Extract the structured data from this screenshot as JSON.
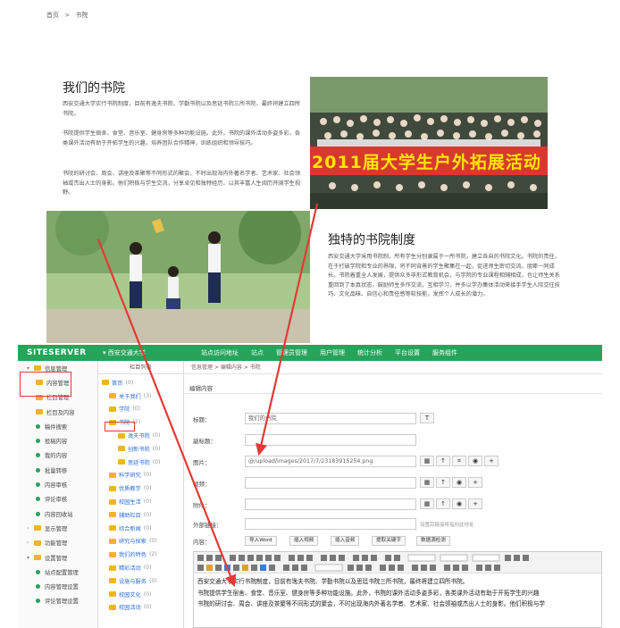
{
  "breadcrumb": {
    "home": "首页",
    "sep": ">",
    "current": "书院"
  },
  "section1": {
    "title": "我们的书院",
    "paragraphs": [
      "西安交通大学实行书院制度，目前有逸夫书院、学勤书院以及思廷书院三所书院，最终将建立四所书院。",
      "书院提供学生宿舍、食堂、音乐室、健身房等多种功能设施。此外，书院的课外活动多姿多彩，各类课外活动有助于开拓学生的兴趣，培养团队合作精神，训练组织和领导技巧。",
      "书院的研讨会、周会、讲座及茶聚等不同形式的聚会，不时出现海内外著名学者、艺术家、社会领袖或杰出人士的身影。他们积极与学生交流，分享卓见和独特经历，以其丰富人生阅历开阔学生视野。"
    ],
    "banner_text": "2011届大学生户外拓展活动"
  },
  "section2": {
    "title": "独特的书院制度",
    "paragraph": "西安交通大学采用书院制，所有学生分别隶属于一所书院，建立各自的书院文化。书院的责任，在于打破学院和专业的界限，将不同背景的学生聚集在一起，促进师生密切交流，朋辈一同成长。书院着重全人发展，提供众多非形式教育机会，与学院的专业课程相辅相成，也让师生关系重回到了本真状态，鼓励师生多作交流，互相学习，并多以学办集体活动来接手学生人际交往技巧、文化品味、自信心和责任感等软技能，发挥个人成长的潜力。"
  },
  "cms": {
    "logo": "SITESERVER",
    "site_selector": "西安交通大学",
    "nav": [
      "站点访问地址",
      "站点",
      "管理员管理",
      "用户管理",
      "统计分析",
      "平台设置",
      "服务组件"
    ],
    "sidebar": [
      "信息管理",
      "内容管理",
      "栏目管理",
      "栏目及内容",
      "稿件搜索",
      "投稿内容",
      "我的内容",
      "批量转移",
      "内容审核",
      "评论审核",
      "内容回收站",
      "显示管理",
      "功能管理",
      "设置管理",
      "站点配置管理",
      "内容管理设置",
      "评论管理设置"
    ],
    "tree_header": "栏目列表",
    "tree": [
      {
        "label": "首页",
        "count": "(0)"
      },
      {
        "label": "关于我们",
        "count": "(3)"
      },
      {
        "label": "学院",
        "count": "(0)"
      },
      {
        "label": "书院",
        "count": "(2)"
      },
      {
        "label": "逸夫书院",
        "count": "(0)"
      },
      {
        "label": "创新书院",
        "count": "(0)"
      },
      {
        "label": "思廷书院",
        "count": "(0)"
      },
      {
        "label": "科学研究",
        "count": "(0)"
      },
      {
        "label": "优质教学",
        "count": "(0)"
      },
      {
        "label": "校园生活",
        "count": "(0)"
      },
      {
        "label": "辅助栏目",
        "count": "(0)"
      },
      {
        "label": "综合新闻",
        "count": "(0)"
      },
      {
        "label": "研究与探索",
        "count": "(0)"
      },
      {
        "label": "我们的特色",
        "count": "(2)"
      },
      {
        "label": "精彩活动",
        "count": "(0)"
      },
      {
        "label": "设施与服务",
        "count": "(0)"
      },
      {
        "label": "校园文化",
        "count": "(0)"
      },
      {
        "label": "校园活动",
        "count": "(0)"
      }
    ],
    "main_breadcrumb": "信息管理 > 编辑内容 > 书院",
    "panel_title": "编辑内容",
    "form": {
      "title_label": "标题：",
      "title_value": "我们的书院",
      "subtitle_label": "副标题：",
      "image_label": "图片：",
      "image_value": "@/upload/images/2017/7/23183915254.png",
      "video_label": "视频：",
      "file_label": "附件：",
      "link_label": "外部链接：",
      "link_hint": "设置后链接将指向此地址",
      "content_label": "内容：",
      "content_buttons": [
        "导入Word",
        "插入视频",
        "插入音频",
        "提取关键字",
        "数据源检测"
      ]
    },
    "editor_text": [
      "西安交通大学实行书院制度，目前有逸夫书院、学勤书院以及思廷书院三所书院，最终将建立四所书院。",
      "书院提供学生宿舍、食堂、音乐室、健身房等多种功能设施。此外，书院的课外活动多姿多彩，各类课外活动有助于开拓学生的兴趣",
      "书院的研讨会、周会、讲座及茶聚等不同形式的聚会，不时出现海内外著名学者、艺术家、社会领袖或杰出人士的身影。他们积极与学"
    ]
  }
}
